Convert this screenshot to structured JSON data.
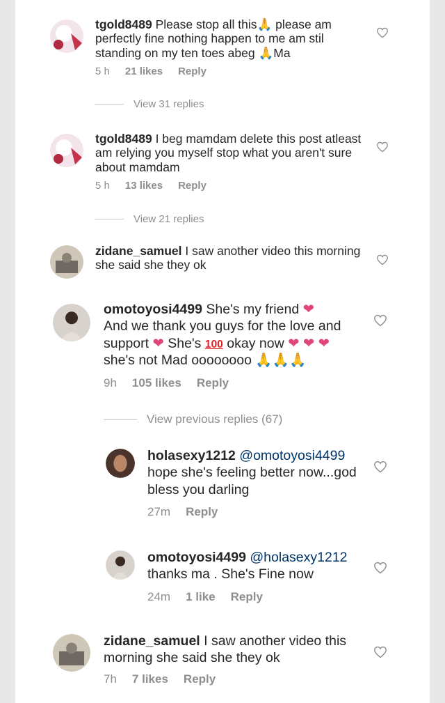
{
  "comments": [
    {
      "username": "tgold8489",
      "text": "Please stop all this🙏 please am perfectly fine nothing happen to me am stil standing on my ten toes abeg 🙏Ma",
      "time": "5 h",
      "likes": "21 likes",
      "reply": "Reply",
      "view_replies": "View 31 replies"
    },
    {
      "username": "tgold8489",
      "text": "I beg mamdam delete this post atleast am relying you myself stop what you aren't sure about mamdam",
      "time": "5 h",
      "likes": "13 likes",
      "reply": "Reply",
      "view_replies": "View 21 replies"
    },
    {
      "username": "zidane_samuel",
      "text": "I saw another video this morning she said she they ok"
    },
    {
      "username": "omotoyosi4499",
      "text_part1": "She's my friend",
      "text_part2": "And we thank you guys for the love and support",
      "text_part3": "She's",
      "text_part4": "okay now",
      "text_part5": "she's not Mad oooooooo",
      "time": "9h",
      "likes": "105 likes",
      "reply": "Reply",
      "view_replies": "View previous replies (67)"
    },
    {
      "username": "holasexy1212",
      "mention": "@omotoyosi4499",
      "text": "hope she's feeling better now...god bless you darling",
      "time": "27m",
      "reply": "Reply"
    },
    {
      "username": "omotoyosi4499",
      "mention": "@holasexy1212",
      "text": "thanks ma .  She's Fine now",
      "time": "24m",
      "likes": "1 like",
      "reply": "Reply"
    },
    {
      "username": "zidane_samuel",
      "text": "I saw another video this morning she said she they ok",
      "time": "7h",
      "likes": "7 likes",
      "reply": "Reply"
    }
  ],
  "emoji": {
    "heart": "❤",
    "pray": "🙏",
    "hundred": "100"
  },
  "icons": [
    "heart-outline-icon",
    "avatar"
  ],
  "colors": {
    "text": "#262626",
    "meta": "#8e8e8e",
    "mention": "#003569",
    "background": "#ffffff",
    "border": "#e8e8e8"
  }
}
